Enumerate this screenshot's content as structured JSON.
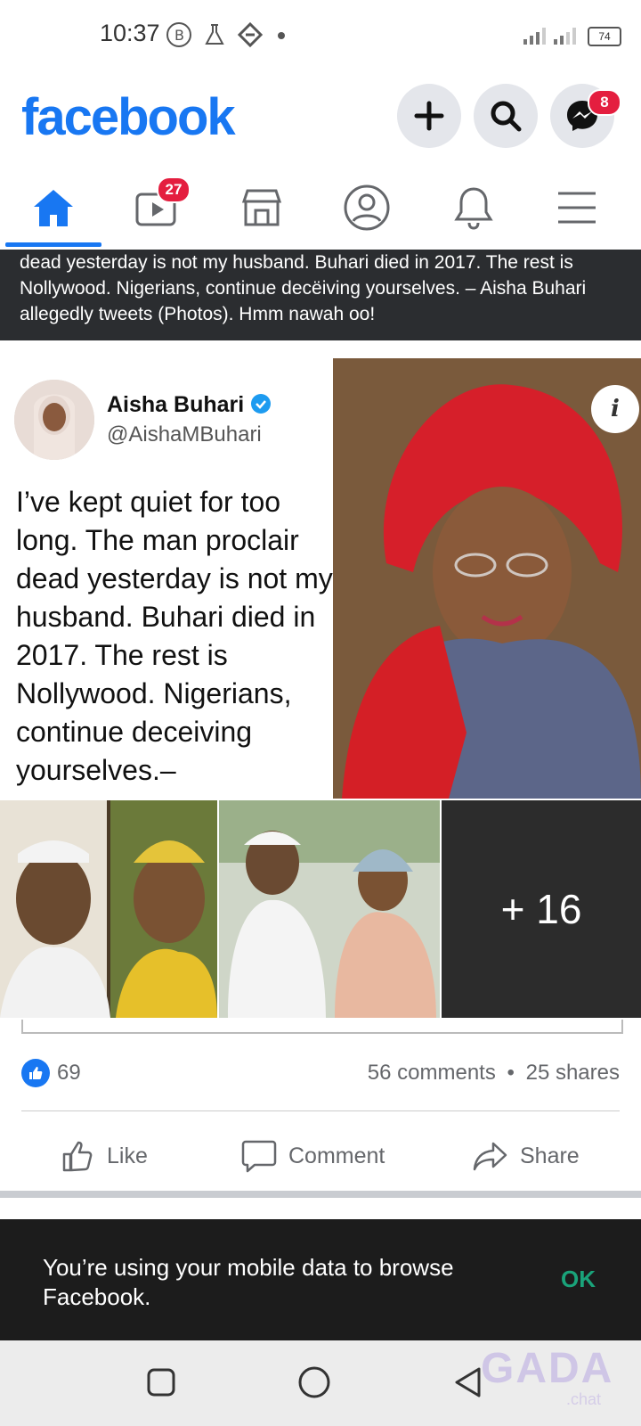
{
  "status_bar": {
    "time": "10:37",
    "battery": "74"
  },
  "header": {
    "brand": "facebook",
    "messenger_badge": "8"
  },
  "nav": {
    "video_badge": "27"
  },
  "banner": {
    "text": "dead yesterday is not my husband. Buhari died in 2017. The rest is Nollywood. Nigerians, continue decëiving yourselves. – Aisha Buhari allegedly tweets (Photos). Hmm nawah oo!"
  },
  "tweet": {
    "name": "Aisha Buhari",
    "handle": "@AishaMBuhari",
    "text": "I’ve kept quiet for too long. The man proclair dead yesterday is not my husband. Buhari died in 2017. The rest is Nollywood. Nigerians, continue deceiving yourselves.–"
  },
  "gallery": {
    "more_label": "+ 16"
  },
  "reactions": {
    "count": "69",
    "comments": "56 comments",
    "shares": "25 shares",
    "dot": "•"
  },
  "actions": {
    "like": "Like",
    "comment": "Comment",
    "share": "Share"
  },
  "toast": {
    "message": "You’re using your mobile data to browse Facebook.",
    "ok": "OK"
  },
  "watermark": {
    "main": "GADA",
    "sub": ".chat"
  },
  "colors": {
    "brand": "#1877f2",
    "badge": "#e41e3f",
    "ok": "#1aa37a"
  },
  "icons": [
    "add-icon",
    "search-icon",
    "messenger-icon",
    "home-icon",
    "video-icon",
    "marketplace-icon",
    "profile-icon",
    "bell-icon",
    "menu-icon",
    "like-icon",
    "comment-icon",
    "share-icon",
    "info-icon"
  ]
}
